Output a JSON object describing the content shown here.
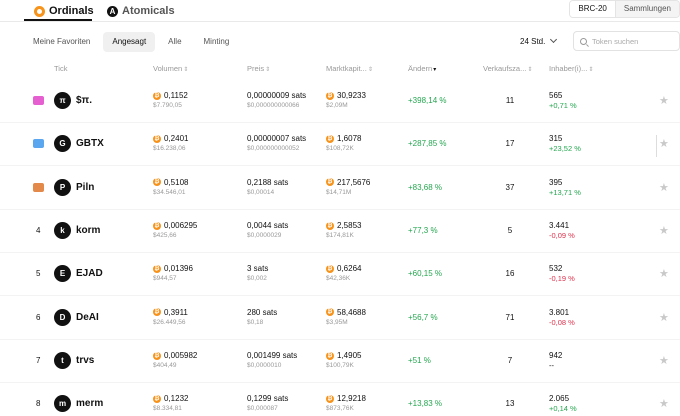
{
  "protocol_tabs": [
    {
      "label": "Ordinals",
      "active": true
    },
    {
      "label": "Atomicals",
      "active": false
    }
  ],
  "standard_toggle": [
    {
      "label": "BRC-20",
      "active": true
    },
    {
      "label": "Sammlungen",
      "active": false
    }
  ],
  "filters": [
    {
      "label": "Meine Favoriten",
      "active": false
    },
    {
      "label": "Angesagt",
      "active": true
    },
    {
      "label": "Alle",
      "active": false
    },
    {
      "label": "Minting",
      "active": false
    }
  ],
  "time_select": {
    "value": "24 Std."
  },
  "search": {
    "placeholder": "Token suchen"
  },
  "columns": {
    "tick": "Tick",
    "volume": "Volumen",
    "price": "Preis",
    "market_cap": "Marktkapit...",
    "change": "Ändern",
    "sales": "Verkaufsza...",
    "holders": "Inhaber(i)..."
  },
  "rows": [
    {
      "rank": "",
      "rank_icon": "gold",
      "ticker": "$π.",
      "logo": "π",
      "volume": "0,1152",
      "volume_usd": "$7.790,05",
      "price": "0,00000009 sats",
      "price_usd": "$0,000000000066",
      "market_cap": "30,9233",
      "market_cap_usd": "$2,09M",
      "change": "+398,14 %",
      "change_dir": "pos",
      "sales": "11",
      "holders": "565",
      "holders_change": "+0,71 %",
      "holders_dir": "pos"
    },
    {
      "rank": "",
      "rank_icon": "silver",
      "ticker": "GBTX",
      "logo": "G",
      "volume": "0,2401",
      "volume_usd": "$16.238,06",
      "price": "0,00000007 sats",
      "price_usd": "$0,000000000052",
      "market_cap": "1,6078",
      "market_cap_usd": "$108,72K",
      "change": "+287,85 %",
      "change_dir": "pos",
      "sales": "17",
      "holders": "315",
      "holders_change": "+23,52 %",
      "holders_dir": "pos"
    },
    {
      "rank": "",
      "rank_icon": "bronze",
      "ticker": "Piln",
      "logo": "P",
      "volume": "0,5108",
      "volume_usd": "$34.546,01",
      "price": "0,2188 sats",
      "price_usd": "$0,00014",
      "market_cap": "217,5676",
      "market_cap_usd": "$14,71M",
      "change": "+83,68 %",
      "change_dir": "pos",
      "sales": "37",
      "holders": "395",
      "holders_change": "+13,71 %",
      "holders_dir": "pos"
    },
    {
      "rank": "4",
      "rank_icon": "",
      "ticker": "korm",
      "logo": "k",
      "volume": "0,006295",
      "volume_usd": "$425,66",
      "price": "0,0044 sats",
      "price_usd": "$0,0000029",
      "market_cap": "2,5853",
      "market_cap_usd": "$174,81K",
      "change": "+77,3 %",
      "change_dir": "pos",
      "sales": "5",
      "holders": "3.441",
      "holders_change": "-0,09 %",
      "holders_dir": "neg"
    },
    {
      "rank": "5",
      "rank_icon": "",
      "ticker": "EJAD",
      "logo": "E",
      "volume": "0,01396",
      "volume_usd": "$944,57",
      "price": "3 sats",
      "price_usd": "$0,002",
      "market_cap": "0,6264",
      "market_cap_usd": "$42,36K",
      "change": "+60,15 %",
      "change_dir": "pos",
      "sales": "16",
      "holders": "532",
      "holders_change": "-0,19 %",
      "holders_dir": "neg"
    },
    {
      "rank": "6",
      "rank_icon": "",
      "ticker": "DeAI",
      "logo": "D",
      "volume": "0,3911",
      "volume_usd": "$26.449,56",
      "price": "280 sats",
      "price_usd": "$0,18",
      "market_cap": "58,4688",
      "market_cap_usd": "$3,95M",
      "change": "+56,7 %",
      "change_dir": "pos",
      "sales": "71",
      "holders": "3.801",
      "holders_change": "-0,08 %",
      "holders_dir": "neg"
    },
    {
      "rank": "7",
      "rank_icon": "",
      "ticker": "trvs",
      "logo": "t",
      "volume": "0,005982",
      "volume_usd": "$404,49",
      "price": "0,001499 sats",
      "price_usd": "$0,0000010",
      "market_cap": "1,4905",
      "market_cap_usd": "$100,79K",
      "change": "+51 %",
      "change_dir": "pos",
      "sales": "7",
      "holders": "942",
      "holders_change": "--",
      "holders_dir": "neu"
    },
    {
      "rank": "8",
      "rank_icon": "",
      "ticker": "merm",
      "logo": "m",
      "volume": "0,1232",
      "volume_usd": "$8.334,81",
      "price": "0,1299 sats",
      "price_usd": "$0,000087",
      "market_cap": "12,9218",
      "market_cap_usd": "$873,76K",
      "change": "+13,83 %",
      "change_dir": "pos",
      "sales": "13",
      "holders": "2.065",
      "holders_change": "+0,14 %",
      "holders_dir": "pos"
    }
  ],
  "colors": {
    "bitcoin_orange": "#f7931a",
    "positive": "#25a750",
    "negative": "#e0334e",
    "rank_gold": "#e55fd1",
    "rank_silver": "#5aa7f0",
    "rank_bronze": "#e38a4a"
  }
}
